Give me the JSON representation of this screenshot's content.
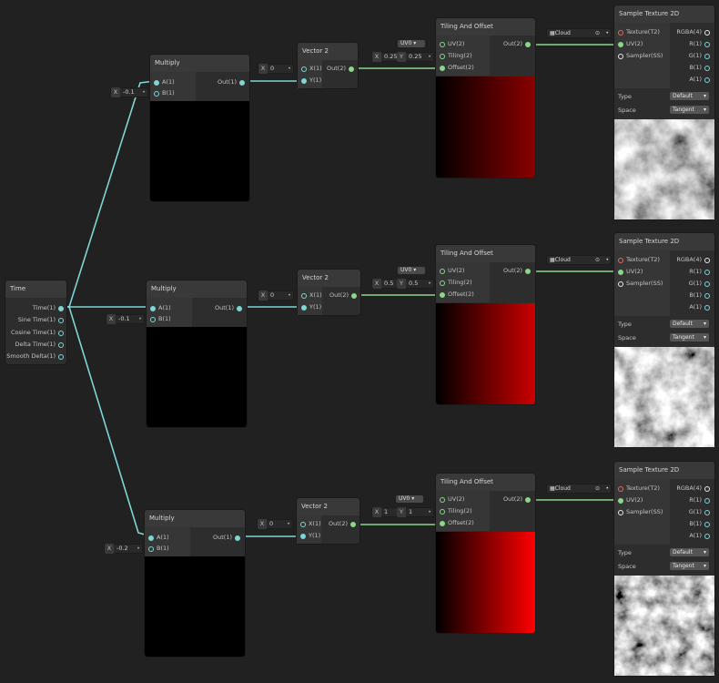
{
  "time_node": {
    "title": "Time",
    "outputs": [
      "Time(1)",
      "Sine Time(1)",
      "Cosine Time(1)",
      "Delta Time(1)",
      "Smooth Delta(1)"
    ]
  },
  "multiply": [
    {
      "title": "Multiply",
      "in_a": "A(1)",
      "in_b": "B(1)",
      "out": "Out(1)",
      "b_label": "X",
      "b_value": "-0.1"
    },
    {
      "title": "Multiply",
      "in_a": "A(1)",
      "in_b": "B(1)",
      "out": "Out(1)",
      "b_label": "X",
      "b_value": "-0.1"
    },
    {
      "title": "Multiply",
      "in_a": "A(1)",
      "in_b": "B(1)",
      "out": "Out(1)",
      "b_label": "X",
      "b_value": "-0.2"
    }
  ],
  "vector2": [
    {
      "title": "Vector 2",
      "in_x": "X(1)",
      "in_y": "Y(1)",
      "out": "Out(2)",
      "x_label": "X",
      "x_value": "0"
    },
    {
      "title": "Vector 2",
      "in_x": "X(1)",
      "in_y": "Y(1)",
      "out": "Out(2)",
      "x_label": "X",
      "x_value": "0"
    },
    {
      "title": "Vector 2",
      "in_x": "X(1)",
      "in_y": "Y(1)",
      "out": "Out(2)",
      "x_label": "X",
      "x_value": "0"
    }
  ],
  "tiling": [
    {
      "title": "Tiling And Offset",
      "uv": "UV(2)",
      "tiling": "Tiling(2)",
      "offset": "Offset(2)",
      "out": "Out(2)",
      "uv_value": "UV0",
      "x_label": "X",
      "x_value": "0.25",
      "y_label": "Y",
      "y_value": "0.25",
      "tint": "#8a0000"
    },
    {
      "title": "Tiling And Offset",
      "uv": "UV(2)",
      "tiling": "Tiling(2)",
      "offset": "Offset(2)",
      "out": "Out(2)",
      "uv_value": "UV0",
      "x_label": "X",
      "x_value": "0.5",
      "y_label": "Y",
      "y_value": "0.5",
      "tint": "#cc0000"
    },
    {
      "title": "Tiling And Offset",
      "uv": "UV(2)",
      "tiling": "Tiling(2)",
      "offset": "Offset(2)",
      "out": "Out(2)",
      "uv_value": "UV0",
      "x_label": "X",
      "x_value": "1",
      "y_label": "Y",
      "y_value": "1",
      "tint": "#ff0000"
    }
  ],
  "sample": [
    {
      "title": "Sample Texture 2D",
      "in_tex": "Texture(T2)",
      "in_uv": "UV(2)",
      "in_sampler": "Sampler(SS)",
      "outs": [
        "RGBA(4)",
        "R(1)",
        "G(1)",
        "B(1)",
        "A(1)"
      ],
      "type_label": "Type",
      "type_value": "Default",
      "space_label": "Space",
      "space_value": "Tangent",
      "texture_name": "Cloud"
    },
    {
      "title": "Sample Texture 2D",
      "in_tex": "Texture(T2)",
      "in_uv": "UV(2)",
      "in_sampler": "Sampler(SS)",
      "outs": [
        "RGBA(4)",
        "R(1)",
        "G(1)",
        "B(1)",
        "A(1)"
      ],
      "type_label": "Type",
      "type_value": "Default",
      "space_label": "Space",
      "space_value": "Tangent",
      "texture_name": "Cloud"
    },
    {
      "title": "Sample Texture 2D",
      "in_tex": "Texture(T2)",
      "in_uv": "UV(2)",
      "in_sampler": "Sampler(SS)",
      "outs": [
        "RGBA(4)",
        "R(1)",
        "G(1)",
        "B(1)",
        "A(1)"
      ],
      "type_label": "Type",
      "type_value": "Default",
      "space_label": "Space",
      "space_value": "Tangent",
      "texture_name": "Cloud"
    }
  ],
  "colors": {
    "float_wire": "#7ed6d6",
    "vector2_wire": "#8ad68a",
    "canvas": "#212121"
  }
}
